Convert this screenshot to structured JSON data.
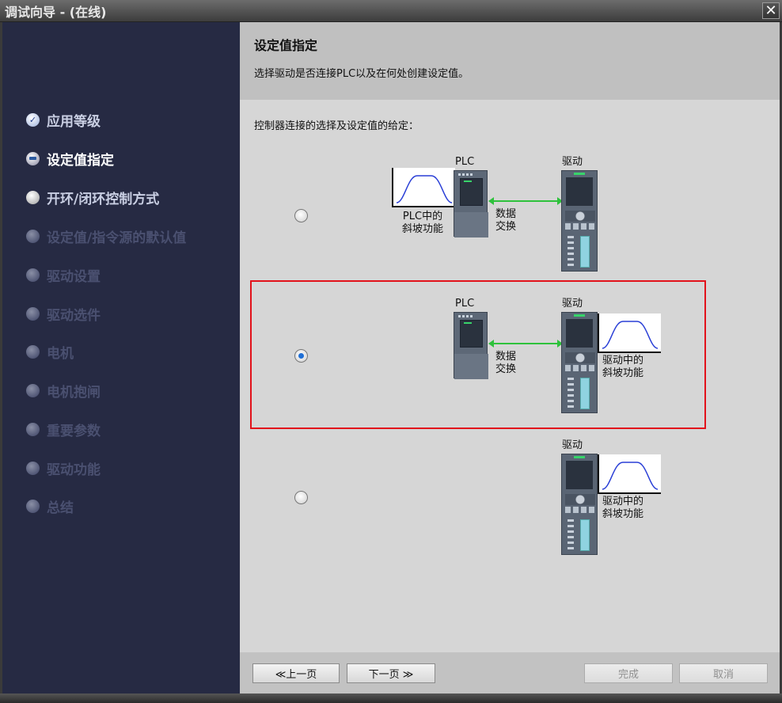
{
  "window": {
    "title": "调试向导 - (在线)",
    "close_glyph": "✕"
  },
  "sidebar": {
    "steps": [
      {
        "label": "应用等级",
        "state": "done"
      },
      {
        "label": "设定值指定",
        "state": "current"
      },
      {
        "label": "开环/闭环控制方式",
        "state": "active"
      },
      {
        "label": "设定值/指令源的默认值",
        "state": "pending"
      },
      {
        "label": "驱动设置",
        "state": "pending"
      },
      {
        "label": "驱动选件",
        "state": "pending"
      },
      {
        "label": "电机",
        "state": "pending"
      },
      {
        "label": "电机抱闸",
        "state": "pending"
      },
      {
        "label": "重要参数",
        "state": "pending"
      },
      {
        "label": "驱动功能",
        "state": "pending"
      },
      {
        "label": "总结",
        "state": "pending"
      }
    ]
  },
  "header": {
    "title": "设定值指定",
    "description": "选择驱动是否连接PLC以及在何处创建设定值。"
  },
  "content": {
    "instruction": "控制器连接的选择及设定值的给定：",
    "options": [
      {
        "selected": false,
        "plc_label": "PLC",
        "drive_label": "驱动",
        "ramp_caption_1": "PLC中的",
        "ramp_caption_2": "斜坡功能",
        "exchange_1": "数据",
        "exchange_2": "交换"
      },
      {
        "selected": true,
        "plc_label": "PLC",
        "drive_label": "驱动",
        "ramp_caption_1": "驱动中的",
        "ramp_caption_2": "斜坡功能",
        "exchange_1": "数据",
        "exchange_2": "交换"
      },
      {
        "selected": false,
        "drive_label": "驱动",
        "ramp_caption_1": "驱动中的",
        "ramp_caption_2": "斜坡功能"
      }
    ]
  },
  "footer": {
    "prev_label": "≪上一页",
    "next_label": "下一页 ≫",
    "finish_label": "完成",
    "cancel_label": "取消"
  },
  "colors": {
    "sidebar_bg": "#262a43",
    "selection_border": "#e2121b",
    "exchange_arrow": "#2ec23c",
    "radio_selected": "#1f6fd6"
  }
}
